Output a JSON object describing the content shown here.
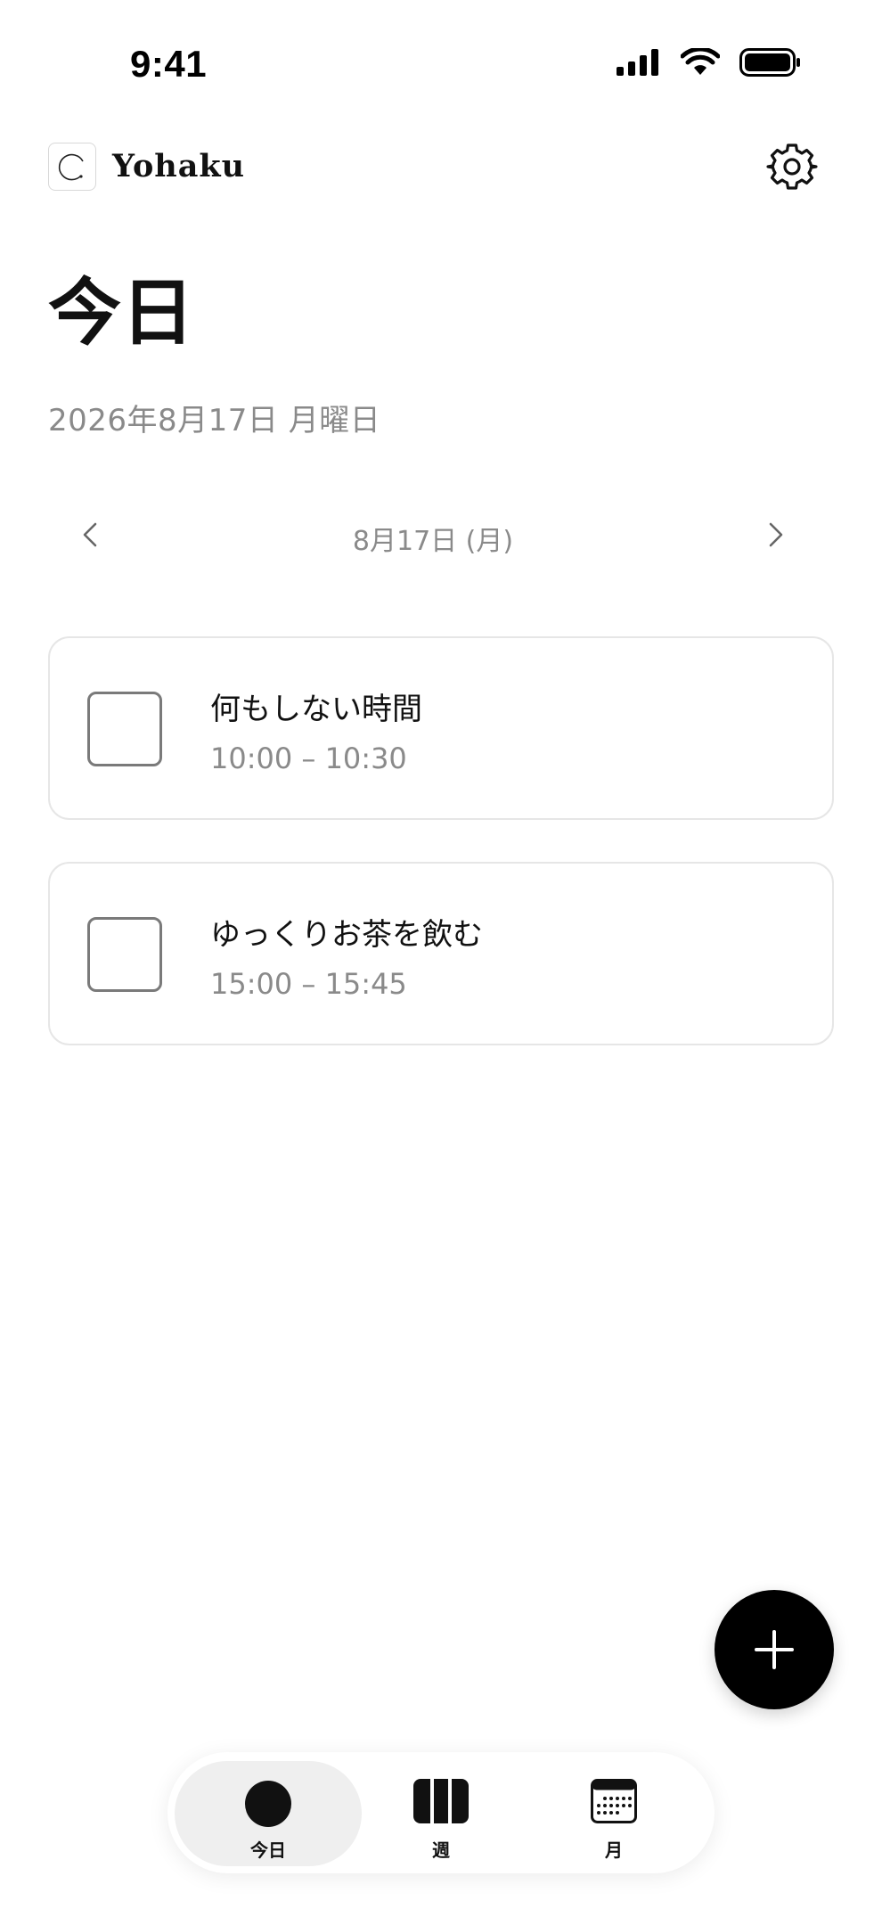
{
  "status_bar": {
    "time": "9:41"
  },
  "header": {
    "app_name": "Yohaku"
  },
  "page": {
    "title": "今日",
    "date_full": "2026年8月17日 月曜日"
  },
  "day_nav": {
    "label": "8月17日 (月)"
  },
  "tasks": [
    {
      "title": "何もしない時間",
      "time": "10:00 – 10:30"
    },
    {
      "title": "ゆっくりお茶を飲む",
      "time": "15:00 – 15:45"
    }
  ],
  "tabs": [
    {
      "label": "今日",
      "icon": "circle-icon",
      "active": true
    },
    {
      "label": "週",
      "icon": "week-columns-icon",
      "active": false
    },
    {
      "label": "月",
      "icon": "calendar-grid-icon",
      "active": false
    }
  ],
  "colors": {
    "accent": "#000000",
    "muted_text": "#8a8a8a",
    "card_border": "#e6e6e6",
    "active_tab_bg": "#efefef"
  }
}
